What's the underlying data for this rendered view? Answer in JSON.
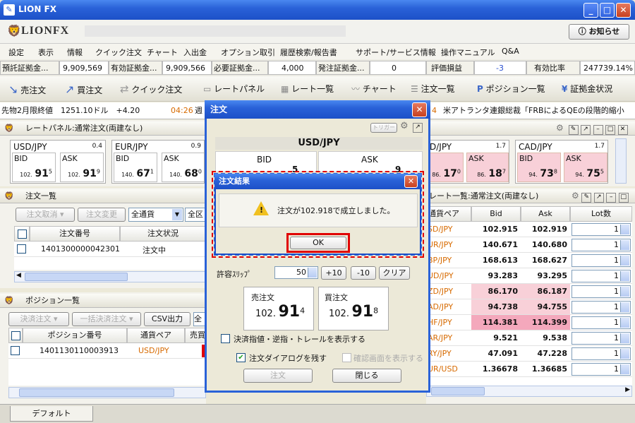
{
  "window": {
    "title": "LION FX",
    "logo_text": "LIONFX",
    "notice_button": "お知らせ"
  },
  "menu": [
    "設定",
    "表示",
    "情報",
    "クイック注文",
    "チャート",
    "入出金",
    "オプション取引",
    "履歴検索/報告書",
    "サポート/サービス情報",
    "操作マニュアル",
    "Q&A"
  ],
  "account": [
    {
      "label": "預託証拠金...",
      "value": "9,909,569"
    },
    {
      "label": "有効証拠金...",
      "value": "9,909,566"
    },
    {
      "label": "必要証拠金...",
      "value": "4,000"
    },
    {
      "label": "発注証拠金...",
      "value": "0"
    },
    {
      "label": "評価損益",
      "value": "-3"
    },
    {
      "label": "有効比率",
      "value": "247739.14%"
    }
  ],
  "toolbar": [
    "売注文",
    "買注文",
    "クイック注文",
    "レートパネル",
    "レート一覧",
    "チャート",
    "注文一覧",
    "ポジション一覧",
    "証拠金状況"
  ],
  "ticker": {
    "left": "先物2月限終値　1251.10ドル　+4.20",
    "time": "04:26",
    "mid": "週",
    "right_num": "4",
    "right": "米アトランタ連銀総裁「FRBによるQEの段階的縮小"
  },
  "rate_panel": {
    "title": "レートパネル:通常注文(両建なし)",
    "cards": [
      {
        "pair": "USD/JPY",
        "spread": "0.4",
        "bid_pre": "102.",
        "bid_big": "91",
        "bid_sup": "5",
        "ask_pre": "102.",
        "ask_big": "91",
        "ask_sup": "9"
      },
      {
        "pair": "EUR/JPY",
        "spread": "0.9",
        "bid_pre": "140.",
        "bid_big": "67",
        "bid_sup": "1",
        "ask_pre": "140.",
        "ask_big": "68",
        "ask_sup": "0"
      },
      {
        "pair": "D/JPY",
        "spread": "1.7",
        "bid_pre": "86.",
        "bid_big": "17",
        "bid_sup": "0",
        "ask_pre": "86.",
        "ask_big": "18",
        "ask_sup": "7"
      },
      {
        "pair": "CAD/JPY",
        "spread": "1.7",
        "bid_pre": "94.",
        "bid_big": "73",
        "bid_sup": "8",
        "ask_pre": "94.",
        "ask_big": "75",
        "ask_sup": "5"
      }
    ],
    "bid_label": "BID",
    "ask_label": "ASK"
  },
  "order_list": {
    "title": "注文一覧",
    "btn_cancel": "注文取消",
    "btn_change": "注文変更",
    "filter": "全通貨",
    "filter2": "全区",
    "col_no": "注文番号",
    "col_status": "注文状況",
    "rows": [
      {
        "no": "1401300000042301",
        "status": "注文中"
      }
    ]
  },
  "position_list": {
    "title": "ポジション一覧",
    "btn_settle": "決済注文",
    "btn_bulk": "一括決済注文",
    "btn_csv": "CSV出力",
    "filter": "全",
    "col_no": "ポジション番号",
    "col_pair": "通貨ペア",
    "col_side": "売買",
    "rows": [
      {
        "no": "1401130110003913",
        "pair": "USD/JPY"
      }
    ]
  },
  "rate_list": {
    "title": "レート一覧:通常注文(両建なし)",
    "col_pair": "通貨ペア",
    "col_bid": "Bid",
    "col_ask": "Ask",
    "col_lot": "Lot数",
    "rows": [
      {
        "pair": "SD/JPY",
        "bid": "102.915",
        "ask": "102.919",
        "lot": "1"
      },
      {
        "pair": "UR/JPY",
        "bid": "140.671",
        "ask": "140.680",
        "lot": "1"
      },
      {
        "pair": "BP/JPY",
        "bid": "168.613",
        "ask": "168.627",
        "lot": "1"
      },
      {
        "pair": "UD/JPY",
        "bid": "93.283",
        "ask": "93.295",
        "lot": "1"
      },
      {
        "pair": "ZD/JPY",
        "bid": "86.170",
        "ask": "86.187",
        "lot": "1"
      },
      {
        "pair": "AD/JPY",
        "bid": "94.738",
        "ask": "94.755",
        "lot": "1"
      },
      {
        "pair": "HF/JPY",
        "bid": "114.381",
        "ask": "114.399",
        "lot": "1"
      },
      {
        "pair": "AR/JPY",
        "bid": "9.521",
        "ask": "9.538",
        "lot": "1"
      },
      {
        "pair": "RY/JPY",
        "bid": "47.091",
        "ask": "47.228",
        "lot": "1"
      },
      {
        "pair": "UR/USD",
        "bid": "1.36678",
        "ask": "1.36685",
        "lot": "1"
      }
    ]
  },
  "order_dialog": {
    "title": "注文",
    "trigger": "トリガー",
    "pair": "USD/JPY",
    "bid": "BID",
    "ask": "ASK",
    "slip_label": "許容ｽﾘｯﾌﾟ",
    "slip_value": "50",
    "plus10": "+10",
    "minus10": "-10",
    "clear": "クリア",
    "sell_label": "売注文",
    "sell_pre": "102.",
    "sell_big": "91",
    "sell_sup": "4",
    "buy_label": "買注文",
    "buy_pre": "102.",
    "buy_big": "91",
    "buy_sup": "8",
    "show_stops": "決済指値・逆指・トレールを表示する",
    "keep_dialog": "注文ダイアログを残す",
    "show_confirm": "確認画面を表示する",
    "order_btn": "注文",
    "close_btn": "閉じる",
    "bg_bid_frag": "5",
    "bg_ask_frag": "9"
  },
  "result_dialog": {
    "title": "注文結果",
    "message": "注文が102.918で成立しました。",
    "ok": "OK"
  },
  "bottom_tab": "デフォルト",
  "colors": {
    "accent_red": "#e00000",
    "pink": "#f8d0d8",
    "pink_strong": "#f4a8bc",
    "orange": "#d76a00",
    "blue_title": "#2a62d8"
  }
}
